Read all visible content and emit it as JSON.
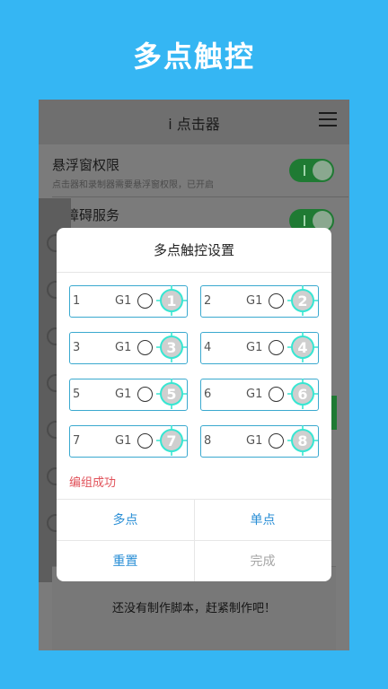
{
  "banner": {
    "title": "多点触控"
  },
  "app": {
    "title": "i 点击器",
    "menu_icon": "hamburger-menu-icon",
    "settings": [
      {
        "title": "悬浮窗权限",
        "subtitle": "点击器和录制器需要悬浮窗权限，已开启",
        "enabled": true
      },
      {
        "title": "无障碍服务",
        "subtitle": "",
        "enabled": true
      }
    ],
    "empty_message": "还没有制作脚本，赶紧制作吧！"
  },
  "dialog": {
    "title": "多点触控设置",
    "slots": [
      {
        "index": "1",
        "group": "G1",
        "target": "1"
      },
      {
        "index": "2",
        "group": "G1",
        "target": "2"
      },
      {
        "index": "3",
        "group": "G1",
        "target": "3"
      },
      {
        "index": "4",
        "group": "G1",
        "target": "4"
      },
      {
        "index": "5",
        "group": "G1",
        "target": "5"
      },
      {
        "index": "6",
        "group": "G1",
        "target": "6"
      },
      {
        "index": "7",
        "group": "G1",
        "target": "7"
      },
      {
        "index": "8",
        "group": "G1",
        "target": "8"
      }
    ],
    "status": "编组成功",
    "buttons": {
      "multi": "多点",
      "single": "单点",
      "reset": "重置",
      "done": "完成"
    },
    "colors": {
      "accent": "#2b8fd6",
      "status": "#e1525a",
      "slot_border": "#3aa9cf",
      "target": "#37e6d2"
    }
  }
}
